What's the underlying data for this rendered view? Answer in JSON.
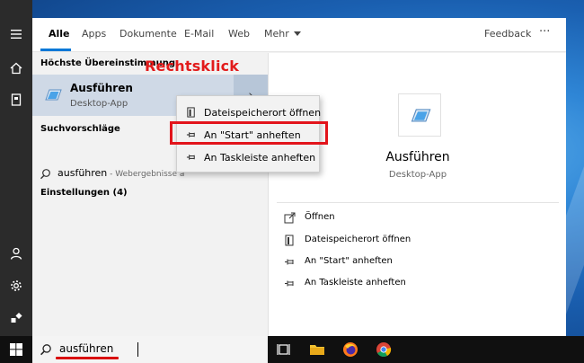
{
  "tabs": [
    "Alle",
    "Apps",
    "Dokumente",
    "E-Mail",
    "Web",
    "Mehr"
  ],
  "feedback": "Feedback",
  "more_dots": "···",
  "best_match": {
    "heading": "Höchste Übereinstimmung",
    "title": "Ausführen",
    "subtitle": "Desktop-App"
  },
  "suggestions": {
    "heading": "Suchvorschläge",
    "query": "ausführen",
    "query_suffix": " - Webergebnisse a"
  },
  "settings_heading": "Einstellungen (4)",
  "annotation": "Rechtsklick",
  "context_menu": [
    {
      "label": "Dateispeicherort öffnen",
      "icon": "folder-file-icon"
    },
    {
      "label": "An \"Start\" anheften",
      "icon": "pin-icon"
    },
    {
      "label": "An Taskleiste anheften",
      "icon": "pin-icon"
    }
  ],
  "detail": {
    "title": "Ausführen",
    "subtitle": "Desktop-App",
    "actions": [
      {
        "label": "Öffnen",
        "icon": "open-icon"
      },
      {
        "label": "Dateispeicherort öffnen",
        "icon": "folder-file-icon"
      },
      {
        "label": "An \"Start\" anheften",
        "icon": "pin-icon"
      },
      {
        "label": "An Taskleiste anheften",
        "icon": "pin-icon"
      }
    ]
  },
  "search": {
    "value": "ausführen"
  },
  "colors": {
    "accent": "#0078d7",
    "annotation": "#e2141b"
  }
}
